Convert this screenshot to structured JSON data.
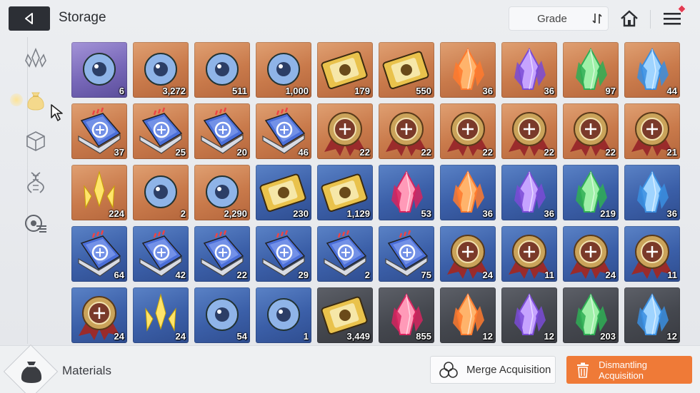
{
  "header": {
    "title": "Storage",
    "sort_label": "Grade"
  },
  "sidebar": {
    "items": [
      {
        "icon": "crystal-outline-icon"
      },
      {
        "icon": "material-pouch-icon",
        "active": true
      },
      {
        "icon": "cube-icon"
      },
      {
        "icon": "dna-icon"
      },
      {
        "icon": "chip-icon"
      }
    ]
  },
  "items": [
    {
      "icon": "dark-core-icon",
      "count": "6",
      "bg": "purple"
    },
    {
      "icon": "blue-swirl-icon",
      "count": "3,272",
      "bg": "orange"
    },
    {
      "icon": "energy-orb-icon",
      "count": "511",
      "bg": "orange"
    },
    {
      "icon": "chip-board-icon",
      "count": "1,000",
      "bg": "orange"
    },
    {
      "icon": "gold-ticket-icon",
      "count": "179",
      "bg": "orange"
    },
    {
      "icon": "rainbow-ticket-icon",
      "count": "550",
      "bg": "orange"
    },
    {
      "icon": "orange-crystal-icon",
      "count": "36",
      "bg": "orange"
    },
    {
      "icon": "purple-crystal-icon",
      "count": "36",
      "bg": "orange"
    },
    {
      "icon": "green-crystal-icon",
      "count": "97",
      "bg": "orange"
    },
    {
      "icon": "blue-crystal-icon",
      "count": "44",
      "bg": "orange"
    },
    {
      "icon": "sword-book-icon",
      "count": "37",
      "bg": "orange"
    },
    {
      "icon": "eye-book-icon",
      "count": "25",
      "bg": "orange"
    },
    {
      "icon": "compass-book-icon",
      "count": "20",
      "bg": "orange"
    },
    {
      "icon": "target-book-icon",
      "count": "46",
      "bg": "orange"
    },
    {
      "icon": "sword-medal-icon",
      "count": "22",
      "bg": "orange"
    },
    {
      "icon": "shield-medal-icon",
      "count": "22",
      "bg": "orange"
    },
    {
      "icon": "eye-medal-icon",
      "count": "22",
      "bg": "orange"
    },
    {
      "icon": "cross-medal-icon",
      "count": "22",
      "bg": "orange"
    },
    {
      "icon": "compass-medal-icon",
      "count": "22",
      "bg": "orange"
    },
    {
      "icon": "target-medal-icon",
      "count": "21",
      "bg": "orange"
    },
    {
      "icon": "yellow-shards-icon",
      "count": "224",
      "bg": "orange"
    },
    {
      "icon": "star-map-icon",
      "count": "2",
      "bg": "orange"
    },
    {
      "icon": "music-scroll-icon",
      "count": "2,290",
      "bg": "orange"
    },
    {
      "icon": "portrait-ticket-icon",
      "count": "230",
      "bg": "blue"
    },
    {
      "icon": "silver-ticket-icon",
      "count": "1,129",
      "bg": "blue"
    },
    {
      "icon": "pink-crystal-icon",
      "count": "53",
      "bg": "blue"
    },
    {
      "icon": "orange-crystal-icon",
      "count": "36",
      "bg": "blue"
    },
    {
      "icon": "purple-crystal-icon",
      "count": "36",
      "bg": "blue"
    },
    {
      "icon": "green-crystal-icon",
      "count": "219",
      "bg": "blue"
    },
    {
      "icon": "blue-crystal-icon",
      "count": "36",
      "bg": "blue"
    },
    {
      "icon": "sword-book-icon",
      "count": "64",
      "bg": "blue"
    },
    {
      "icon": "shield-book-icon",
      "count": "42",
      "bg": "blue"
    },
    {
      "icon": "eye-book-icon",
      "count": "22",
      "bg": "blue"
    },
    {
      "icon": "cross-book-icon",
      "count": "29",
      "bg": "blue"
    },
    {
      "icon": "compass-book-icon",
      "count": "2",
      "bg": "blue"
    },
    {
      "icon": "target-book-icon",
      "count": "75",
      "bg": "blue"
    },
    {
      "icon": "sword-medal-icon",
      "count": "24",
      "bg": "blue"
    },
    {
      "icon": "shield-medal-icon",
      "count": "11",
      "bg": "blue"
    },
    {
      "icon": "eye-medal-icon",
      "count": "24",
      "bg": "blue"
    },
    {
      "icon": "cross-medal-icon",
      "count": "11",
      "bg": "blue"
    },
    {
      "icon": "compass-medal-icon",
      "count": "24",
      "bg": "blue"
    },
    {
      "icon": "blue-shards-icon",
      "count": "24",
      "bg": "blue"
    },
    {
      "icon": "cake-icon",
      "count": "54",
      "bg": "blue"
    },
    {
      "icon": "bouquet-icon",
      "count": "1",
      "bg": "blue"
    },
    {
      "icon": "silver-ticket-icon",
      "count": "3,449",
      "bg": "gray"
    },
    {
      "icon": "pink-crystal-icon",
      "count": "855",
      "bg": "gray"
    },
    {
      "icon": "orange-crystal-icon",
      "count": "12",
      "bg": "gray"
    },
    {
      "icon": "purple-crystal-icon",
      "count": "12",
      "bg": "gray"
    },
    {
      "icon": "green-crystal-icon",
      "count": "203",
      "bg": "gray"
    },
    {
      "icon": "blue-crystal-icon",
      "count": "12",
      "bg": "gray"
    }
  ],
  "footer": {
    "category_label": "Materials",
    "merge_label": "Merge Acquisition",
    "dismantle_label": "Dismantling Acquisition"
  },
  "colors": {
    "accent_orange": "#ef7a37",
    "dark": "#2c2f35"
  }
}
